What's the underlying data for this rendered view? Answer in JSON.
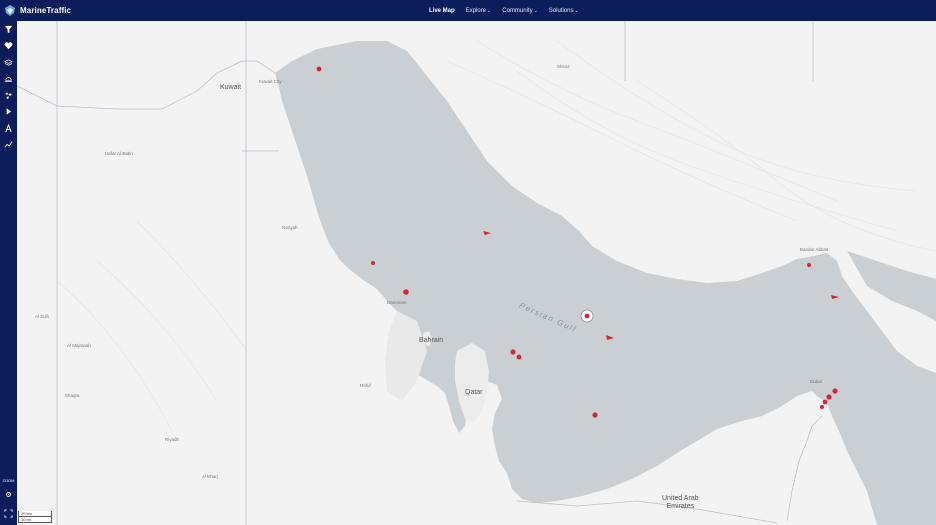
{
  "app": {
    "name": "MarineTraffic"
  },
  "nav": {
    "items": [
      {
        "label": "Live Map",
        "active": true,
        "dropdown": false
      },
      {
        "label": "Explore",
        "active": false,
        "dropdown": true
      },
      {
        "label": "Community",
        "active": false,
        "dropdown": true
      },
      {
        "label": "Solutions",
        "active": false,
        "dropdown": true
      }
    ]
  },
  "sidebar": {
    "icons": [
      "filter-icon",
      "heart-icon",
      "layers-icon",
      "weather-icon",
      "density-icon",
      "play-icon",
      "measure-icon",
      "chart-icon"
    ],
    "zoom_level": "ZOOM",
    "bottom_icons": [
      "settings-icon",
      "fullscreen-icon"
    ]
  },
  "map": {
    "sea_label": "Persian Gulf",
    "places": {
      "kuwait": "Kuwait",
      "kuwait_city": "Kuwait City",
      "hafar": "Hafar Al-Batin",
      "nariyah": "Nariyah",
      "dammam": "Dammam",
      "bahrain": "Bahrain",
      "qatar": "Qatar",
      "hofuf": "Hofuf",
      "riyadh": "Riyadh",
      "al_majmaah": "Al Majmaah",
      "al_zulfi": "Al Zulfi",
      "shagra": "Shagra",
      "al_kharj": "Al Kharj",
      "uae": "United Arab\nEmirates",
      "bandar_abbas": "Bandar Abbas",
      "shiraz": "Shiraz",
      "dubai": "Dubai"
    },
    "scale": {
      "km": "20 km",
      "mi": "10 mi"
    }
  },
  "colors": {
    "nav_bg": "#0b1e5b",
    "water": "#c9cfd3",
    "land": "#f3f3f3",
    "vessel": "#d8262f"
  }
}
